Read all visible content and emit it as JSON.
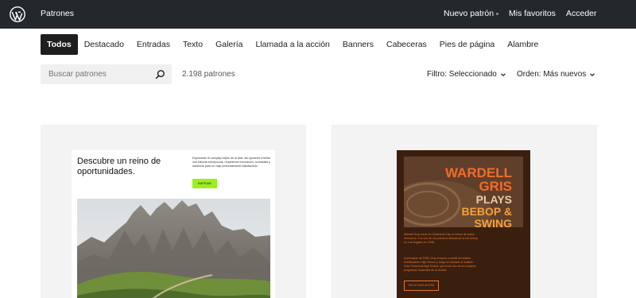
{
  "header": {
    "site_title": "Patrones",
    "nav": {
      "new_pattern": "Nuevo patrón",
      "favorites": "Mis favoritos",
      "login": "Acceder"
    }
  },
  "categories": [
    {
      "label": "Todos",
      "active": true
    },
    {
      "label": "Destacado"
    },
    {
      "label": "Entradas"
    },
    {
      "label": "Texto"
    },
    {
      "label": "Galería"
    },
    {
      "label": "Llamada a la acción"
    },
    {
      "label": "Banners"
    },
    {
      "label": "Cabeceras"
    },
    {
      "label": "Pies de página"
    },
    {
      "label": "Alambre"
    }
  ],
  "toolbar": {
    "search_placeholder": "Buscar patrones",
    "count": "2.198 patrones",
    "filter_label": "Filtro: Seleccionado",
    "order_label": "Orden: Más nuevos"
  },
  "cards": [
    {
      "heading": "Descubre un reino de oportunidades.",
      "description": "Explorando el complejo tejido de la vida, las opciones revelan una historia excepcional, requiriendo innovación, curiosidad y sabiduría para un viaje profundamente satisfactorio.",
      "cta": "EMPEZAR"
    },
    {
      "headline_lines": [
        "WARDELL",
        "GRIS",
        "PLAYS",
        "BEBOP &",
        "SWING"
      ],
      "text1": "Wardell Gray nació en Oklahoma City, el menor de cuatro hermanos. Fue uno de los primeros artistas de la era bebop en Los Ángeles en 1938.",
      "text2": "A principios de 1936, Gray empezó a asistir al instituto Northeastern High School y luego se trasladó al Instituto Cass Technical High School, que tenía uno de los mejores programas musicales de la ciudad.",
      "button": "ESCUCHAR AHORA"
    }
  ],
  "colors": {
    "topbar": "#23282d",
    "accent_green": "#9cf01e",
    "poster_bg": "#3a1f0f",
    "poster_orange": "#f26b2a"
  }
}
